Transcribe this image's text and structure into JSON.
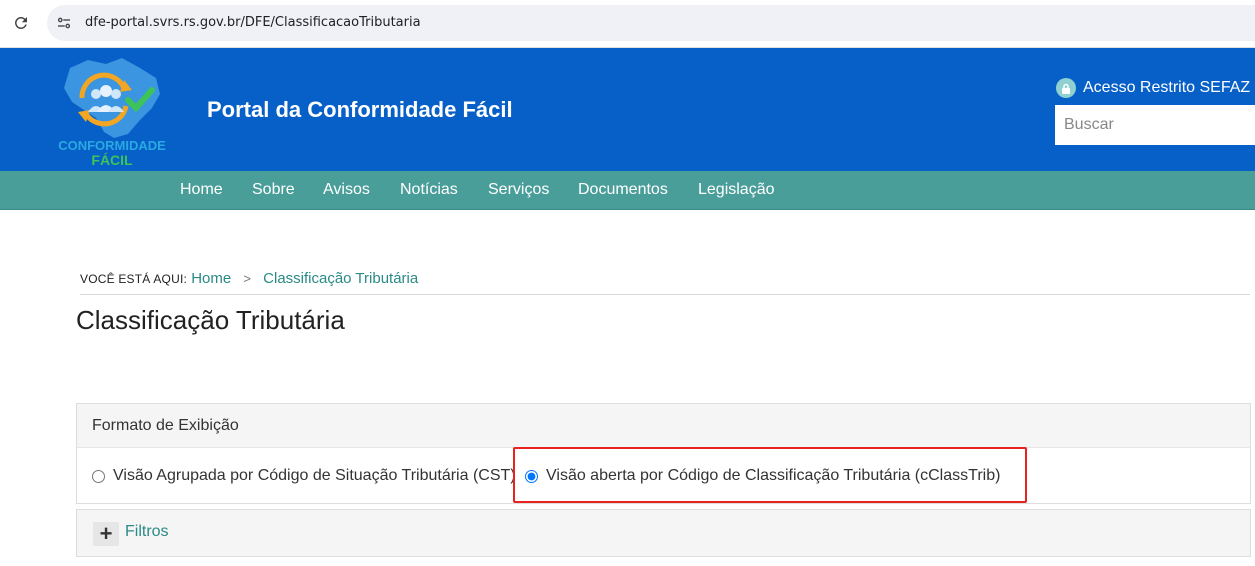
{
  "browser": {
    "url": "dfe-portal.svrs.rs.gov.br/DFE/ClassificacaoTributaria"
  },
  "header": {
    "logo_line1": "CONFORMIDADE",
    "logo_line2": "FÁCIL",
    "site_title": "Portal da Conformidade Fácil",
    "restricted_access": "Acesso Restrito SEFAZ",
    "search_placeholder": "Buscar"
  },
  "nav": {
    "items": [
      "Home",
      "Sobre",
      "Avisos",
      "Notícias",
      "Serviços",
      "Documentos",
      "Legislação"
    ]
  },
  "breadcrumb": {
    "prefix": "VOCÊ ESTÁ AQUI:",
    "home": "Home",
    "separator": ">",
    "current": "Classificação Tributária"
  },
  "page": {
    "title": "Classificação Tributária"
  },
  "display_format": {
    "heading": "Formato de Exibição",
    "option_cst": "Visão Agrupada por Código de Situação Tributária (CST)",
    "option_cclasstrib": "Visão aberta por Código de Classificação Tributária (cClassTrib)",
    "selected": "cclasstrib"
  },
  "filters": {
    "label": "Filtros",
    "toggle": "+"
  },
  "colors": {
    "header_blue": "#0760c8",
    "nav_teal": "#4a9e9a",
    "link_teal": "#2a8a86",
    "highlight_red": "#e8231f"
  }
}
